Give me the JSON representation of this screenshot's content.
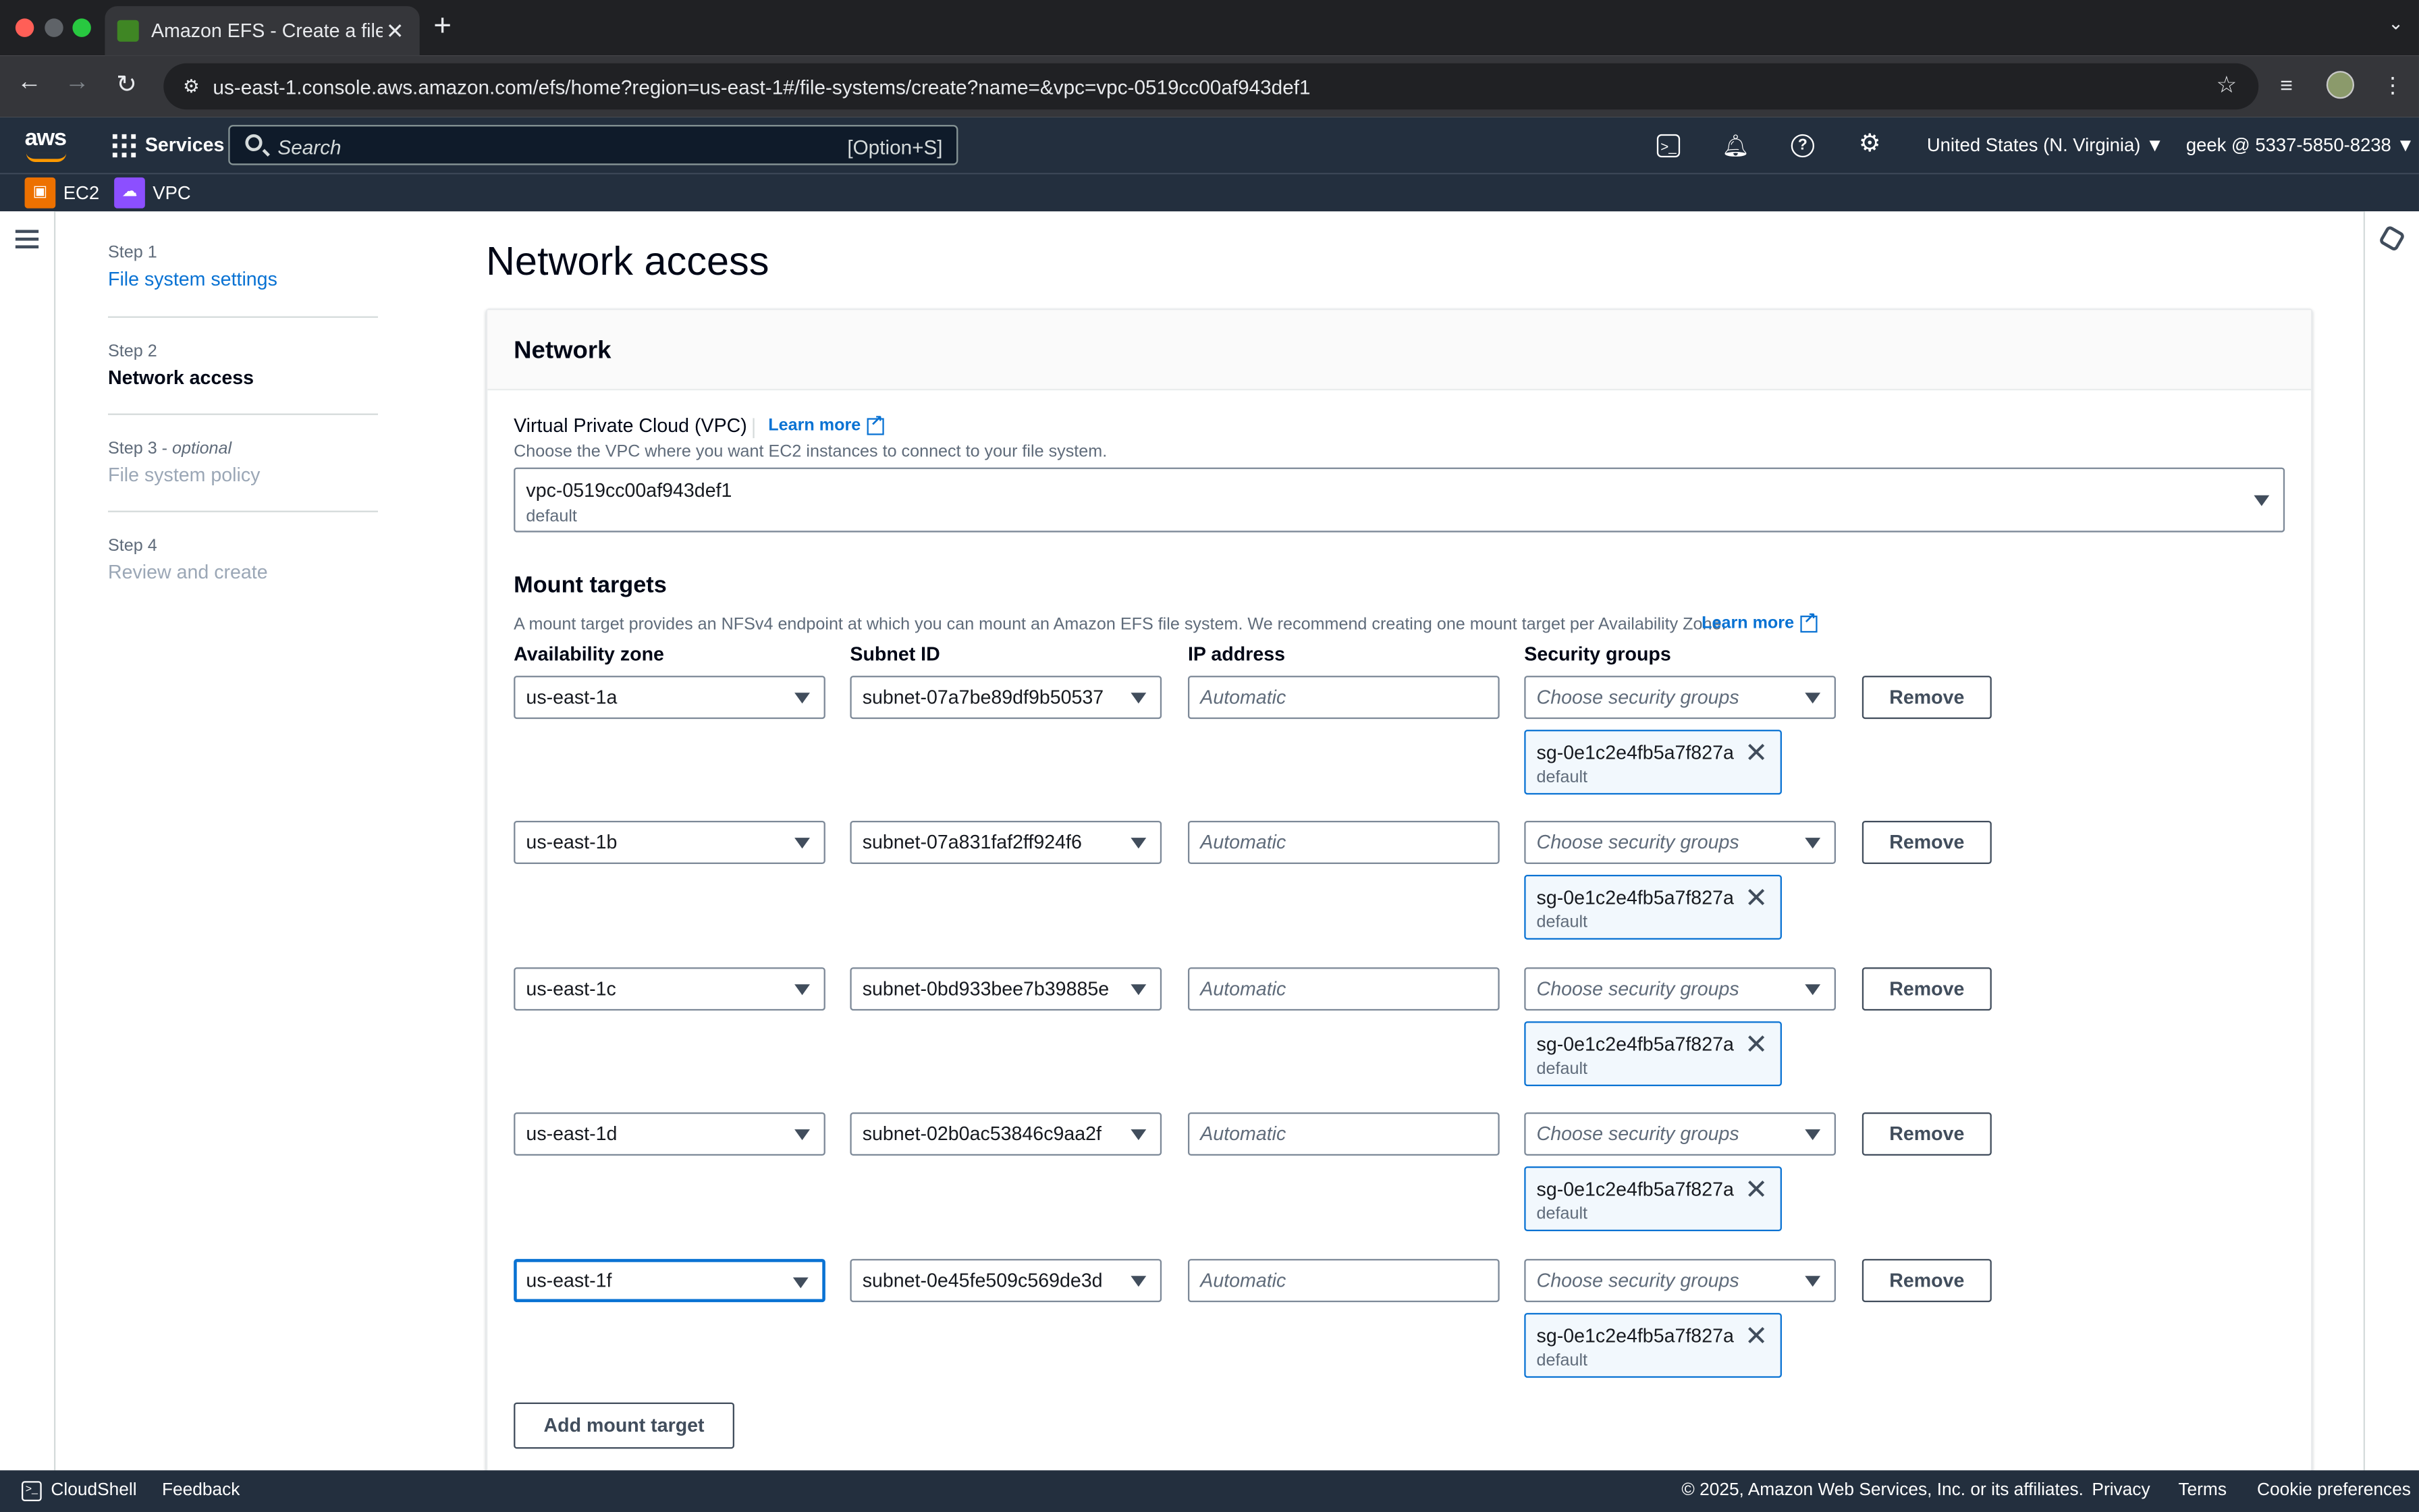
{
  "browser": {
    "tab_title": "Amazon EFS - Create a file sy",
    "url": "us-east-1.console.aws.amazon.com/efs/home?region=us-east-1#/file-systems/create?name=&vpc=vpc-0519cc00af943def1"
  },
  "aws_nav": {
    "services_label": "Services",
    "search_placeholder": "Search",
    "search_shortcut": "[Option+S]",
    "region": "United States (N. Virginia) ▼",
    "account": "geek @ 5337-5850-8238 ▼",
    "favorites": [
      {
        "label": "EC2"
      },
      {
        "label": "VPC"
      }
    ]
  },
  "steps": [
    {
      "label": "Step 1",
      "optional": "",
      "value": "File system settings",
      "state": "link"
    },
    {
      "label": "Step 2",
      "optional": "",
      "value": "Network access",
      "state": "current"
    },
    {
      "label": "Step 3 - ",
      "optional": "optional",
      "value": "File system policy",
      "state": "disabled"
    },
    {
      "label": "Step 4",
      "optional": "",
      "value": "Review and create",
      "state": "disabled"
    }
  ],
  "page": {
    "title": "Network access"
  },
  "network": {
    "heading": "Network",
    "vpc_label": "Virtual Private Cloud (VPC)",
    "learn_more": "Learn more",
    "vpc_description": "Choose the VPC where you want EC2 instances to connect to your file system.",
    "vpc_value": "vpc-0519cc00af943def1",
    "vpc_subvalue": "default"
  },
  "mount_targets": {
    "heading": "Mount targets",
    "description": "A mount target provides an NFSv4 endpoint at which you can mount an Amazon EFS file system. We recommend creating one mount target per Availability Zone.",
    "learn_more": "Learn more",
    "columns": {
      "az": "Availability zone",
      "subnet": "Subnet ID",
      "ip": "IP address",
      "sg": "Security groups"
    },
    "ip_placeholder": "Automatic",
    "sg_placeholder": "Choose security groups",
    "remove_label": "Remove",
    "add_label": "Add mount target",
    "rows": [
      {
        "az": "us-east-1a",
        "subnet": "subnet-07a7be89df9b50537",
        "sg_name": "sg-0e1c2e4fb5a7f827a",
        "sg_desc": "default"
      },
      {
        "az": "us-east-1b",
        "subnet": "subnet-07a831faf2ff924f6",
        "sg_name": "sg-0e1c2e4fb5a7f827a",
        "sg_desc": "default"
      },
      {
        "az": "us-east-1c",
        "subnet": "subnet-0bd933bee7b39885e",
        "sg_name": "sg-0e1c2e4fb5a7f827a",
        "sg_desc": "default"
      },
      {
        "az": "us-east-1d",
        "subnet": "subnet-02b0ac53846c9aa2f",
        "sg_name": "sg-0e1c2e4fb5a7f827a",
        "sg_desc": "default"
      },
      {
        "az": "us-east-1f",
        "subnet": "subnet-0e45fe509c569de3d",
        "sg_name": "sg-0e1c2e4fb5a7f827a",
        "sg_desc": "default"
      }
    ]
  },
  "footer": {
    "cloudshell": "CloudShell",
    "feedback": "Feedback",
    "copyright": "© 2025, Amazon Web Services, Inc. or its affiliates.",
    "privacy": "Privacy",
    "terms": "Terms",
    "cookies": "Cookie preferences"
  }
}
